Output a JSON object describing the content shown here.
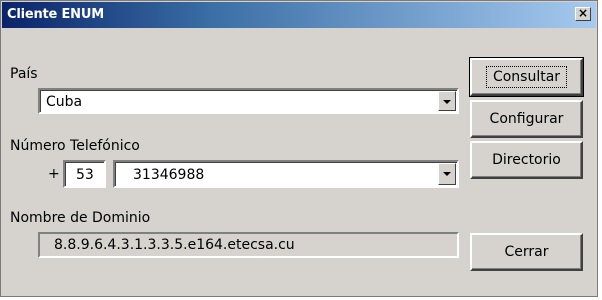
{
  "window": {
    "title": "Cliente ENUM",
    "close_label": "×"
  },
  "form": {
    "country_label": "País",
    "country_value": "Cuba",
    "phone_label": "Número Telefónico",
    "plus_sign": "+",
    "country_code": "53",
    "phone_number": "31346988",
    "domain_label": "Nombre de Dominio",
    "domain_value": "8.8.9.6.4.3.1.3.3.5.e164.etecsa.cu"
  },
  "buttons": {
    "consultar": "Consultar",
    "configurar": "Configurar",
    "directorio": "Directorio",
    "cerrar": "Cerrar"
  }
}
